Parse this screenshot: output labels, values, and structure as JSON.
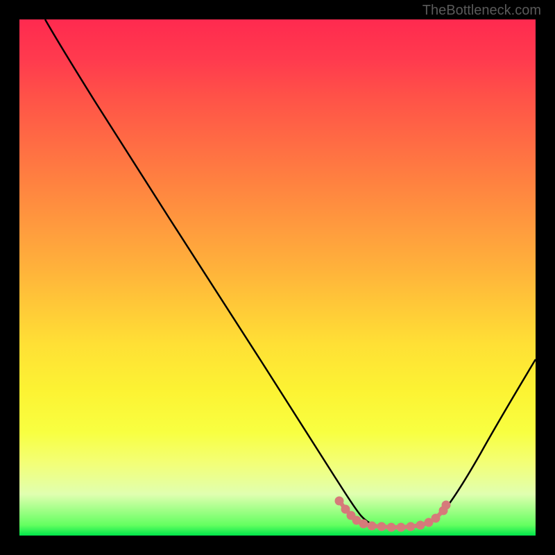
{
  "watermark": "TheBottleneck.com",
  "chart_data": {
    "type": "line",
    "title": "",
    "xlabel": "",
    "ylabel": "",
    "xlim": [
      0,
      100
    ],
    "ylim": [
      0,
      100
    ],
    "series": [
      {
        "name": "main-curve",
        "color": "#000000",
        "x": [
          5,
          10,
          15,
          20,
          25,
          30,
          35,
          40,
          45,
          50,
          55,
          60,
          62,
          65,
          68,
          72,
          76,
          80,
          82,
          85,
          90,
          95,
          100
        ],
        "y": [
          100,
          93,
          85,
          77,
          69,
          61,
          53,
          45,
          37,
          29,
          21,
          12,
          8,
          4,
          2,
          1,
          1,
          2,
          4,
          8,
          16,
          25,
          34
        ]
      },
      {
        "name": "marker-band",
        "color": "#d97a7a",
        "x": [
          62,
          64,
          66,
          68,
          70,
          72,
          74,
          76,
          78,
          80,
          82
        ],
        "y": [
          6,
          4,
          3,
          2.2,
          1.8,
          1.6,
          1.6,
          2,
          3,
          4,
          6
        ]
      }
    ],
    "gradient": {
      "top_color": "#ff2a4f",
      "mid_color": "#ffe035",
      "bottom_color": "#00e54a"
    }
  }
}
